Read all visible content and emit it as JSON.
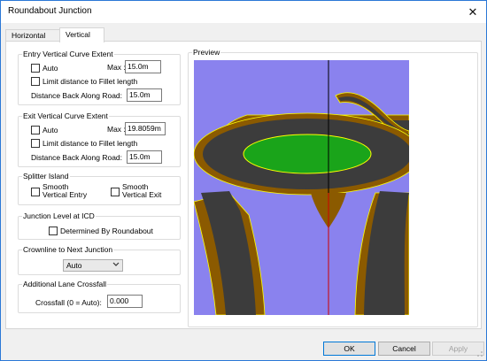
{
  "window": {
    "title": "Roundabout Junction",
    "close_glyph": "✕"
  },
  "tabs": [
    {
      "label": "Horizontal",
      "active": false
    },
    {
      "label": "Vertical",
      "active": true
    }
  ],
  "entry_extent": {
    "title": "Entry Vertical Curve Extent",
    "auto_label": "Auto",
    "auto_checked": false,
    "max_label": "Max :",
    "max_value": "15.0m",
    "limit_label": "Limit distance to Fillet length",
    "limit_checked": false,
    "distance_label": "Distance Back Along Road:",
    "distance_value": "15.0m"
  },
  "exit_extent": {
    "title": "Exit Vertical Curve Extent",
    "auto_label": "Auto",
    "auto_checked": false,
    "max_label": "Max :",
    "max_value": "19.8059m",
    "limit_label": "Limit distance to Fillet length",
    "limit_checked": false,
    "distance_label": "Distance Back Along Road:",
    "distance_value": "15.0m"
  },
  "splitter": {
    "title": "Splitter Island",
    "entry_line1": "Smooth",
    "entry_line2": "Vertical Entry",
    "entry_checked": false,
    "exit_line1": "Smooth",
    "exit_line2": "Vertical Exit",
    "exit_checked": false
  },
  "junction_level": {
    "title": "Junction Level at ICD",
    "determined_label": "Determined By Roundabout",
    "determined_checked": false
  },
  "crownline": {
    "title": "Crownline to Next Junction",
    "selected": "Auto"
  },
  "crossfall": {
    "title": "Additional Lane Crossfall",
    "label": "Crossfall (0 = Auto):",
    "value": "0.000"
  },
  "preview": {
    "title": "Preview",
    "colors": {
      "sky": "#8a82ee",
      "asphalt": "#3c3c3c",
      "verge": "#8b5a00",
      "island": "#1aa41a",
      "edge_line": "#ffff00",
      "axis_line": "#000000",
      "center_line": "#cc0000"
    }
  },
  "buttons": {
    "ok": "OK",
    "cancel": "Cancel",
    "apply": "Apply"
  }
}
